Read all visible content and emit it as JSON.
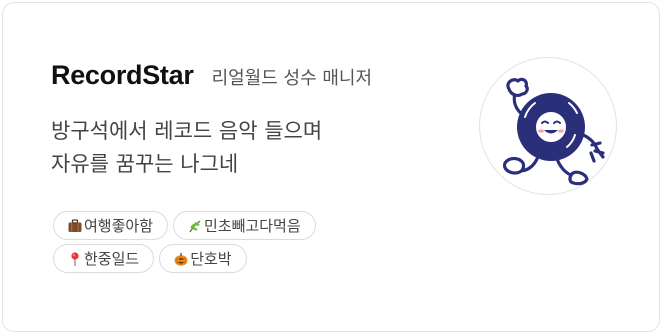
{
  "profile": {
    "nickname": "RecordStar",
    "role": "리얼월드 성수 매니저",
    "bio_line1": "방구석에서 레코드 음악 들으며",
    "bio_line2": "자유를 꿈꾸는 나그네",
    "avatar_icon": "walking-vinyl-record-character-icon"
  },
  "tags": [
    {
      "icon": "suitcase-icon",
      "label": "여행좋아함"
    },
    {
      "icon": "herb-icon",
      "label": "민초빼고다먹음"
    },
    {
      "icon": "pin-icon",
      "label": "한중일드"
    },
    {
      "icon": "pumpkin-icon",
      "label": "단호박"
    }
  ],
  "colors": {
    "accent_navy": "#2b2f7a",
    "text_primary": "#111111",
    "text_secondary": "#444444"
  }
}
